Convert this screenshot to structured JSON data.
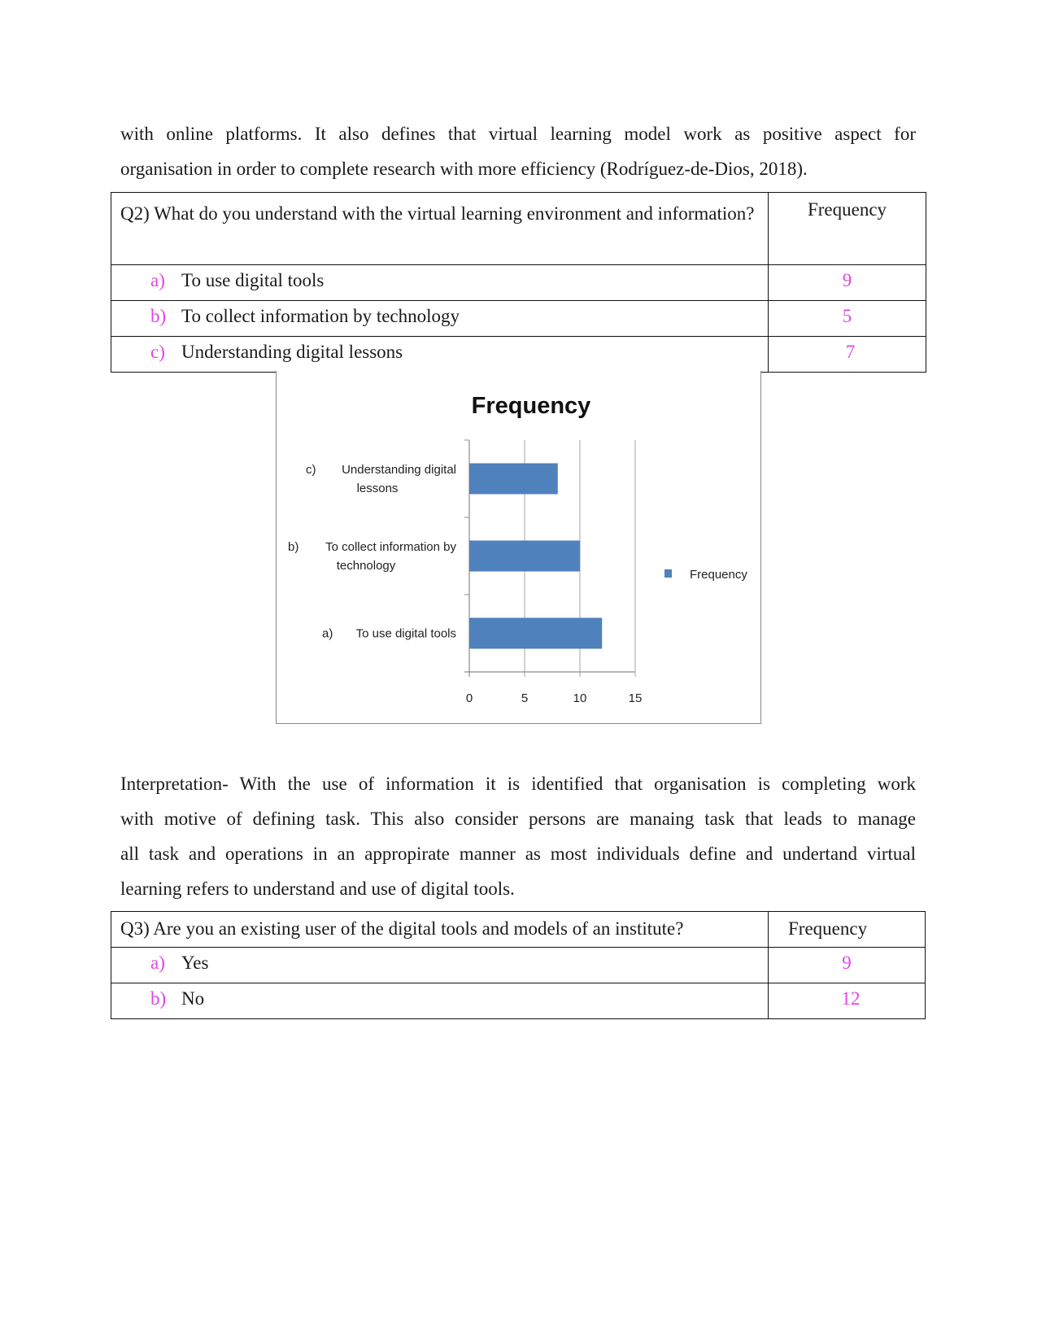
{
  "intro_paragraph": {
    "lines": [
      "with online platforms. It also defines that virtual learning model work as positive aspect for",
      "organisation in order to complete research with more efficiency (Rodríguez-de-Dios, 2018)."
    ]
  },
  "q2_table": {
    "question": "Q2) What do you understand with the virtual learning environment and information?",
    "frequency_header": "Frequency",
    "options": [
      {
        "marker": "a)",
        "label": "To use digital tools",
        "frequency": "9"
      },
      {
        "marker": "b)",
        "label": "To collect information by technology",
        "frequency": "5"
      },
      {
        "marker": "c)",
        "label": "Understanding digital lessons",
        "frequency": "7"
      }
    ]
  },
  "chart_data": {
    "type": "bar",
    "orientation": "horizontal",
    "title": "Frequency",
    "categories": [
      "a)      To use digital tools",
      "b)      To collect information by technology",
      "c)      Understanding digital lessons"
    ],
    "category_lines": [
      [
        {
          "marker": "a)",
          "text": "To use digital tools"
        }
      ],
      [
        {
          "marker": "b)",
          "text": "To collect information by"
        },
        {
          "marker": "",
          "text": "technology"
        }
      ],
      [
        {
          "marker": "c)",
          "text": "Understanding digital"
        },
        {
          "marker": "",
          "text": "lessons"
        }
      ]
    ],
    "series": [
      {
        "name": "Frequency",
        "values": [
          12,
          10,
          8
        ],
        "color": "#4f81bd"
      }
    ],
    "xlabel": "",
    "ylabel": "",
    "xlim": [
      0,
      15
    ],
    "xticks": [
      "0",
      "5",
      "10",
      "15"
    ],
    "grid": true,
    "legend": {
      "entries": [
        "Frequency"
      ],
      "position": "right"
    }
  },
  "interpretation_paragraph": {
    "lines": [
      "Interpretation- With the use of information it is identified that organisation is completing work",
      "with motive of defining task. This also consider persons are manaing task that leads to manage",
      "all task and operations in an appropirate manner as most individuals define and undertand virtual",
      "learning refers to understand and use of digital tools."
    ]
  },
  "q3_table": {
    "question": "Q3) Are you an existing user of the digital tools and models of an institute?",
    "frequency_header": "Frequency",
    "options": [
      {
        "marker": "a)",
        "label": "Yes",
        "frequency": "9"
      },
      {
        "marker": "b)",
        "label": "No",
        "frequency": "12"
      }
    ]
  },
  "colors": {
    "option_marker": "#e244e6",
    "bar": "#4f81bd",
    "table_border": "#111111"
  }
}
